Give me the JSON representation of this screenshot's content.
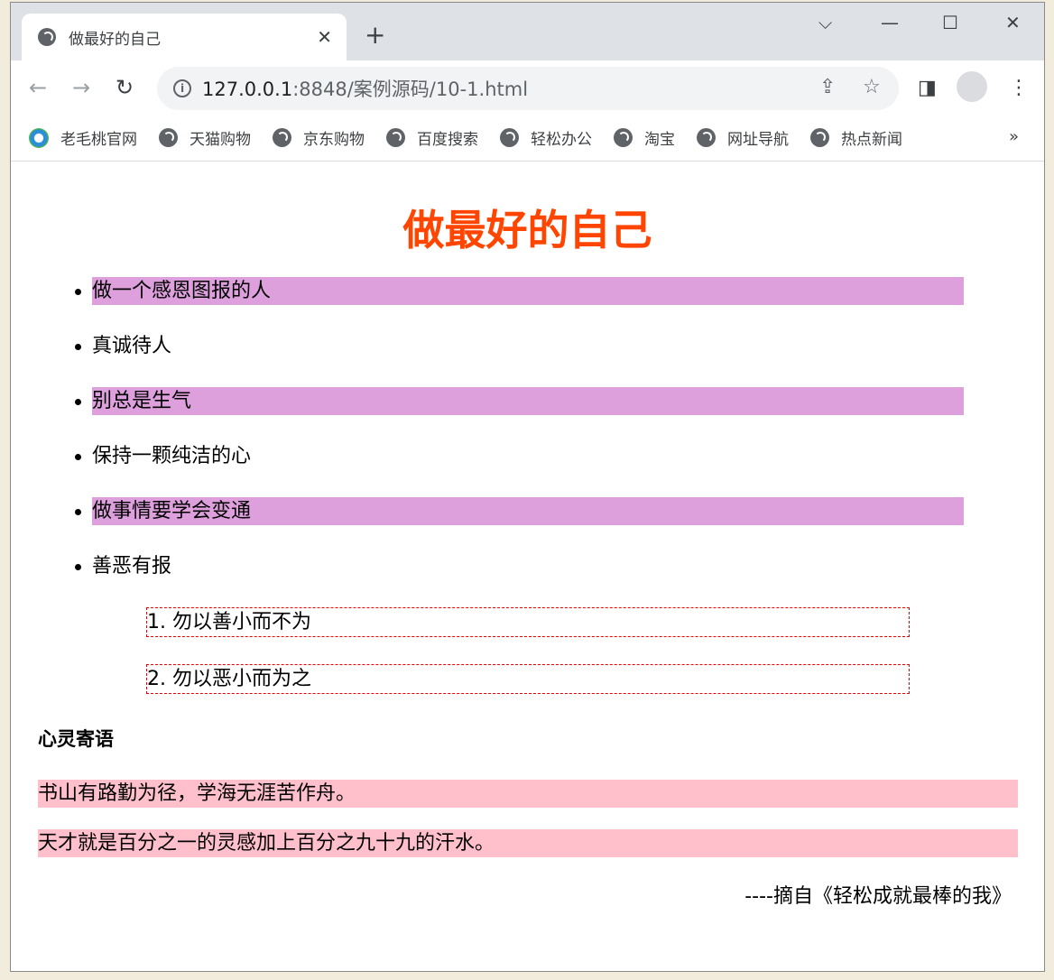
{
  "browser": {
    "tab_title": "做最好的自己",
    "url_host": "127.0.0.1",
    "url_path": ":8848/案例源码/10-1.html",
    "bookmarks": [
      "老毛桃官网",
      "天猫购物",
      "京东购物",
      "百度搜索",
      "轻松办公",
      "淘宝",
      "网址导航",
      "热点新闻"
    ]
  },
  "page": {
    "title": "做最好的自己",
    "items": [
      "做一个感恩图报的人",
      "真诚待人",
      "别总是生气",
      "保持一颗纯洁的心",
      "做事情要学会变通",
      "善恶有报"
    ],
    "sub_items": [
      "1. 勿以善小而不为",
      "2. 勿以恶小而为之"
    ],
    "heading": "心灵寄语",
    "quotes": [
      "书山有路勤为径，学海无涯苦作舟。",
      "天才就是百分之一的灵感加上百分之九十九的汗水。"
    ],
    "source": "----摘自《轻松成就最棒的我》"
  },
  "colors": {
    "title": "#ff4500",
    "highlight": "#dda0dd",
    "quote_bg": "#ffc0cb"
  }
}
